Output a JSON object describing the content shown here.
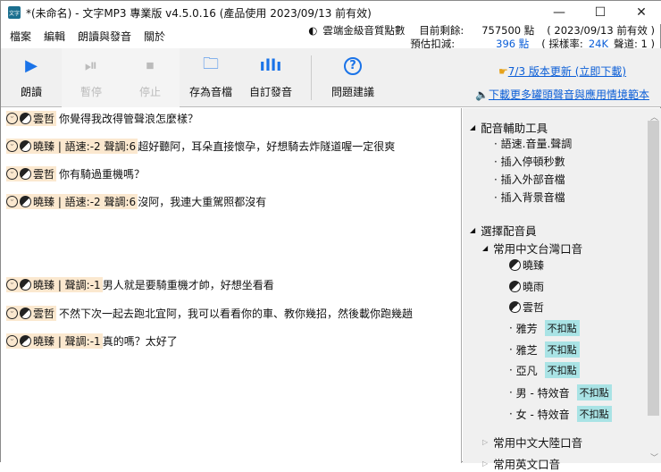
{
  "window": {
    "title": "*(未命名) - 文字MP3 專業版 v4.5.0.16 (產品使用 2023/09/13 前有效)",
    "minimize": "—",
    "maximize": "☐",
    "close": "✕"
  },
  "menu": [
    "檔案",
    "編輯",
    "朗讀與發音",
    "關於"
  ],
  "points": {
    "label": "雲端金級音質點數",
    "remaining_label": "目前剩餘:",
    "remaining_value": "757500 點",
    "valid": "( 2023/09/13 前有效 )",
    "estimate_label": "預估扣減:",
    "estimate_value": "396 點",
    "rate_prefix": "( 採樣率:",
    "rate_value": "24K",
    "channel": "聲道: 1 )"
  },
  "toolbar": {
    "play": "朗讀",
    "pause": "暫停",
    "stop": "停止",
    "save": "存為音檔",
    "custom": "自訂發音",
    "help": "問題建議",
    "update_link": "7/3 版本更新 (立即下載)",
    "download_link": "下載更多罐頭聲音與應用情境範本"
  },
  "lines": [
    {
      "tag": "雲哲",
      "text": "你覺得我改得管聲浪怎麼樣？"
    },
    {
      "tag": "曉臻 | 語速:-2 聲調:6",
      "text": "超好聽阿，耳朵直接懷孕，好想騎去炸隧道喔一定很爽"
    },
    {
      "tag": "雲哲",
      "text": "你有騎過重機嗎？"
    },
    {
      "tag": "曉臻 | 語速:-2 聲調:6",
      "text": "沒阿，我連大重駕照都沒有"
    },
    {
      "tag": "曉臻 | 聲調:-1",
      "text": "男人就是要騎重機才帥，好想坐看看"
    },
    {
      "tag": "雲哲",
      "text": "不然下次一起去跑北宜阿，我可以看看你的車、教你幾招，然後載你跑幾趟"
    },
    {
      "tag": "曉臻 | 聲調:-1",
      "text": "真的嗎？太好了"
    }
  ],
  "panel": {
    "tools_header": "配音輔助工具",
    "tools": [
      "語速.音量.聲調",
      "插入停頓秒數",
      "插入外部音檔",
      "插入背景音檔"
    ],
    "voices_header": "選擇配音員",
    "group1": "常用中文台灣口音",
    "cloud_voices": [
      "曉臻",
      "曉雨",
      "雲哲"
    ],
    "free_voices": [
      "雅芳",
      "雅芝",
      "亞凡",
      "男 - 特效音",
      "女 - 特效音"
    ],
    "free_badge": "不扣點",
    "group2": "常用中文大陸口音",
    "group3": "常用英文口音"
  }
}
